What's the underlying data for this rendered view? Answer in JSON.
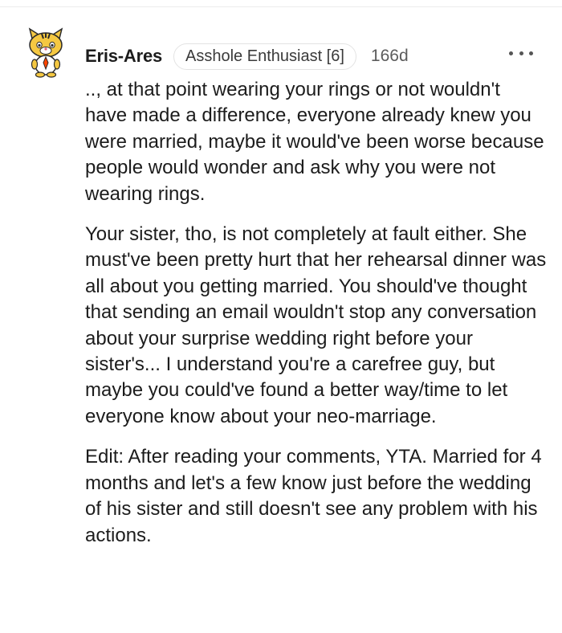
{
  "comment": {
    "username": "Eris-Ares",
    "flair": "Asshole Enthusiast [6]",
    "age": "166d",
    "more_label": "•••",
    "paragraphs": [
      ".., at that point wearing your rings or not wouldn't have made a difference, everyone already knew you were married, maybe it would've been worse because people would wonder and ask why you were not wearing rings.",
      "Your sister, tho, is not completely at fault either. She must've been pretty hurt that her rehearsal dinner was all about you getting married. You should've thought that sending an email wouldn't stop any conversation about your surprise wedding right before your sister's... I understand you're a carefree guy, but maybe you could've found a better way/time to let everyone know about your neo-marriage.",
      "Edit: After reading your comments, YTA. Married for 4 months and let's a few know just before the wedding of his sister and still doesn't see any problem with his actions."
    ]
  },
  "icons": {
    "avatar": "snoo-tiger-avatar",
    "more": "more-options-icon"
  },
  "colors": {
    "text": "#1c1c1c",
    "meta": "#5c5c5c",
    "flair_border": "#e3e3e3",
    "avatar_yellow": "#f5c842"
  }
}
